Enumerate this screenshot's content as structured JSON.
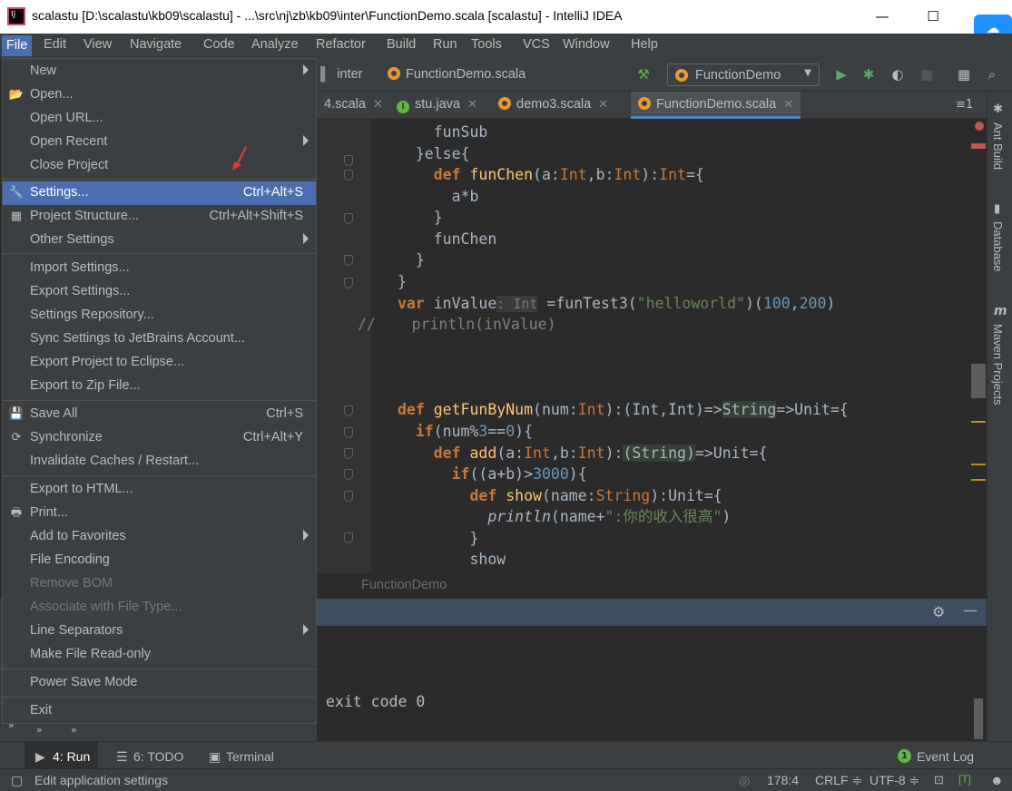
{
  "window": {
    "title": "scalastu [D:\\scalastu\\kb09\\scalastu] - ...\\src\\nj\\zb\\kb09\\inter\\FunctionDemo.scala [scalastu] - IntelliJ IDEA",
    "minimize": "—",
    "maximize": "☐",
    "close": "✕"
  },
  "menubar": [
    "File",
    "Edit",
    "View",
    "Navigate",
    "Code",
    "Analyze",
    "Refactor",
    "Build",
    "Run",
    "Tools",
    "VCS",
    "Window",
    "Help"
  ],
  "navbar": {
    "crumb1": "inter",
    "crumb2": "FunctionDemo.scala",
    "run_config": "FunctionDemo"
  },
  "tabs": [
    {
      "label": "4.scala"
    },
    {
      "label": "stu.java"
    },
    {
      "label": "demo3.scala"
    },
    {
      "label": "FunctionDemo.scala"
    }
  ],
  "tabs_menu": "≡1",
  "file_menu": {
    "items": [
      {
        "label": "New",
        "submenu": true
      },
      {
        "label": "Open..."
      },
      {
        "label": "Open URL..."
      },
      {
        "label": "Open Recent",
        "submenu": true
      },
      {
        "label": "Close Project"
      },
      {
        "label": "Settings...",
        "shortcut": "Ctrl+Alt+S"
      },
      {
        "label": "Project Structure...",
        "shortcut": "Ctrl+Alt+Shift+S"
      },
      {
        "label": "Other Settings",
        "submenu": true
      },
      {
        "label": "Import Settings..."
      },
      {
        "label": "Export Settings..."
      },
      {
        "label": "Settings Repository..."
      },
      {
        "label": "Sync Settings to JetBrains Account..."
      },
      {
        "label": "Export Project to Eclipse..."
      },
      {
        "label": "Export to Zip File..."
      },
      {
        "label": "Save All",
        "shortcut": "Ctrl+S"
      },
      {
        "label": "Synchronize",
        "shortcut": "Ctrl+Alt+Y"
      },
      {
        "label": "Invalidate Caches / Restart..."
      },
      {
        "label": "Export to HTML..."
      },
      {
        "label": "Print..."
      },
      {
        "label": "Add to Favorites",
        "submenu": true
      },
      {
        "label": "File Encoding"
      },
      {
        "label": "Remove BOM"
      },
      {
        "label": "Associate with File Type..."
      },
      {
        "label": "Line Separators",
        "submenu": true
      },
      {
        "label": "Make File Read-only"
      },
      {
        "label": "Power Save Mode"
      },
      {
        "label": "Exit"
      }
    ]
  },
  "code_tokens": {
    "funSub": "funSub",
    "else": "}else{",
    "def": "def",
    "funChen": "funChen",
    "aInt": "(a:",
    "Int": "Int",
    "bInt": ",b:",
    "closeEq": "):",
    "eqBrace": "={",
    "axb": "a*b",
    "brace": "}",
    "funChenCall": "funChen",
    "var": "var",
    "inValue": "inValue",
    "hint": ": Int",
    "assign": " =funTest3(",
    "helloworld": "\"helloworld\"",
    "args": ")(",
    "n100": "100",
    "comma": ",",
    "n200": "200",
    "close": ")",
    "comment": "//    println(inValue)",
    "getFunByNum": "getFunByNum",
    "numInt": "(num:",
    "arrow": "):(Int,Int)=>",
    "String": "String",
    "unitEq": "=>Unit={",
    "if": "if",
    "numMod": "(num%",
    "n3": "3",
    "eqeq": "==",
    "n0": "0",
    "parenBrace": "){",
    "add": "add",
    "ifcond": "((a+b)>",
    "n3000": "3000",
    "show": "show",
    "nameStr": "(name:",
    "unitBrace": "):Unit={",
    "println": "println",
    "namePlus": "(name+",
    "msg": "\":你的收入很高\"",
    "showCall": "show"
  },
  "editor_breadcrumb": "FunctionDemo",
  "run_output": "exit code 0",
  "bottom_tabs": [
    {
      "label": "4: Run"
    },
    {
      "label": "6: TODO"
    },
    {
      "label": "Terminal"
    }
  ],
  "event_log": "Event Log",
  "event_log_count": "1",
  "status": {
    "message": "Edit application settings",
    "position": "178:4",
    "line_sep": "CRLF ≑",
    "encoding": "UTF-8 ≑",
    "lock": "🔓",
    "mode": "[T]"
  },
  "right_stripe": [
    "Ant Build",
    "Database",
    "Maven Projects"
  ],
  "colors": {
    "accent": "#4b6eaf",
    "background": "#2b2b2b",
    "panel": "#3c3f41"
  }
}
